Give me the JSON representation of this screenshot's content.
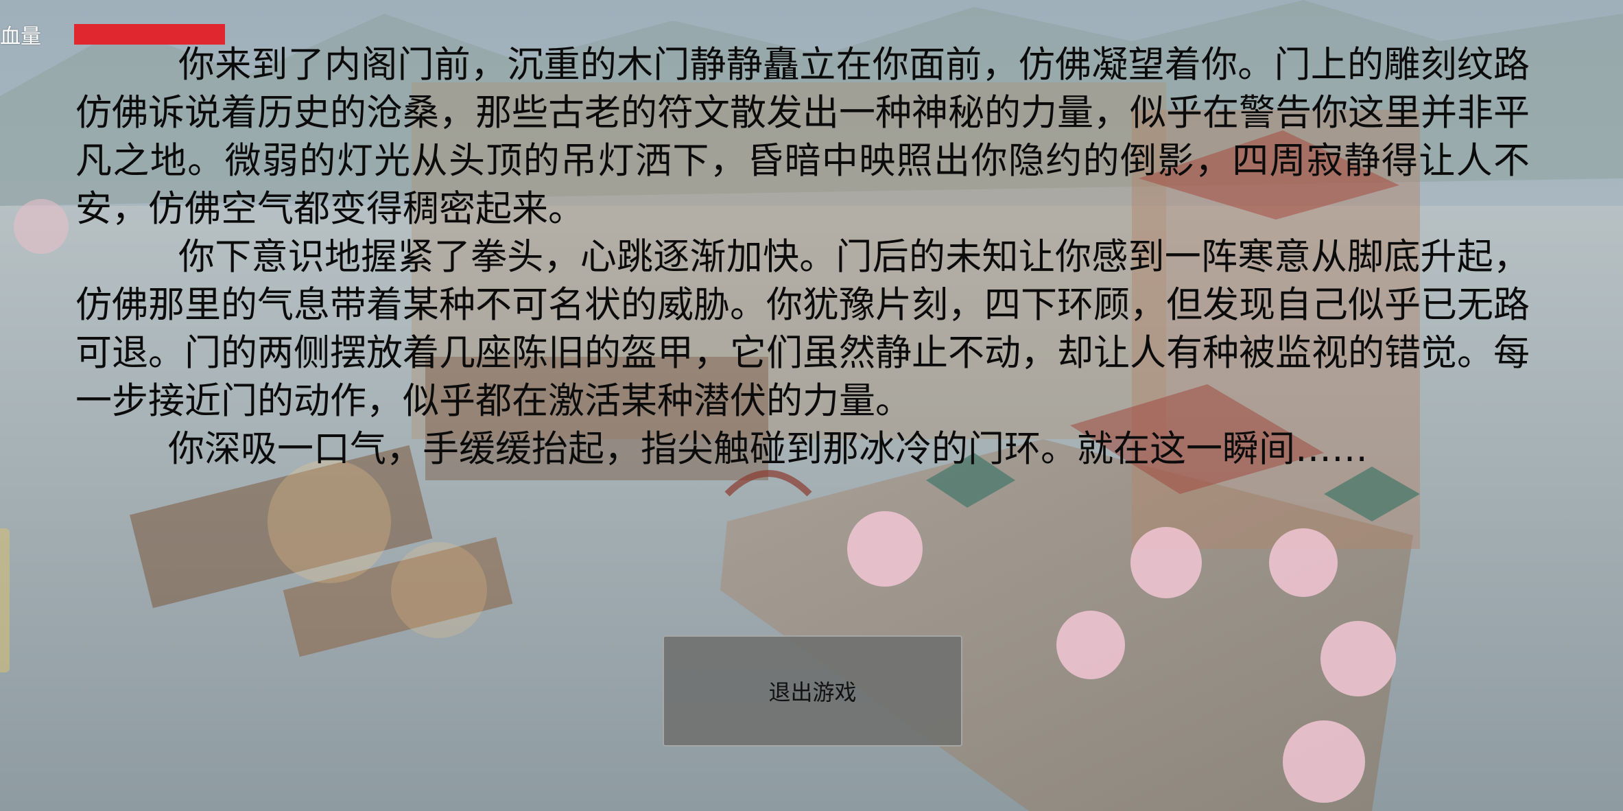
{
  "hud": {
    "hp_label": "血量",
    "hp_fraction": 1.0,
    "hp_color": "#e0262f"
  },
  "story": {
    "paragraphs": [
      "你来到了内阁门前，沉重的木门静静矗立在你面前，仿佛凝望着你。门上的雕刻纹路仿佛诉说着历史的沧桑，那些古老的符文散发出一种神秘的力量，似乎在警告你这里并非平凡之地。微弱的灯光从头顶的吊灯洒下，昏暗中映照出你隐约的倒影，四周寂静得让人不安，仿佛空气都变得稠密起来。",
      "你下意识地握紧了拳头，心跳逐渐加快。门后的未知让你感到一阵寒意从脚底升起，仿佛那里的气息带着某种不可名状的威胁。你犹豫片刻，四下环顾，但发现自己似乎已无路可退。门的两侧摆放着几座陈旧的盔甲，它们虽然静止不动，却让人有种被监视的错觉。每一步接近门的动作，似乎都在激活某种潜伏的力量。",
      "你深吸一口气，手缓缓抬起，指尖触碰到那冰冷的门环。就在这一瞬间……"
    ]
  },
  "buttons": {
    "exit_label": "退出游戏"
  },
  "colors": {
    "text": "#0b0b0b",
    "button_bg": "#6e706e"
  }
}
